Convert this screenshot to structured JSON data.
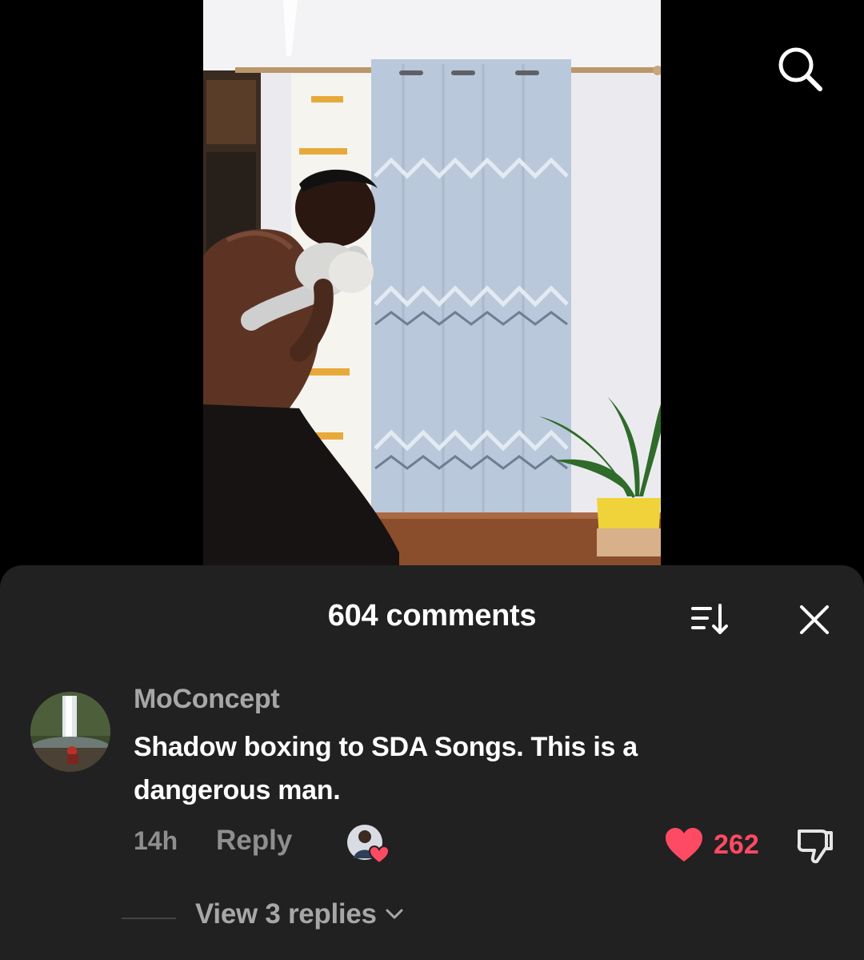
{
  "video": {
    "description_icon": "video-frame"
  },
  "top_bar": {
    "search_icon": "search-icon"
  },
  "comments_sheet": {
    "title": "604 comments",
    "sort_icon": "sort-icon",
    "close_icon": "close-icon"
  },
  "comment": {
    "username": "MoConcept",
    "text": "Shadow boxing to SDA Songs. This is a dangerous man.",
    "timestamp": "14h",
    "reply_label": "Reply",
    "like_count": "262",
    "liked": true,
    "creator_heart": true,
    "view_replies_label": "View 3 replies"
  },
  "colors": {
    "sheet_bg": "#212121",
    "like_red": "#ff4a63",
    "muted_text": "#a7a7a7"
  }
}
